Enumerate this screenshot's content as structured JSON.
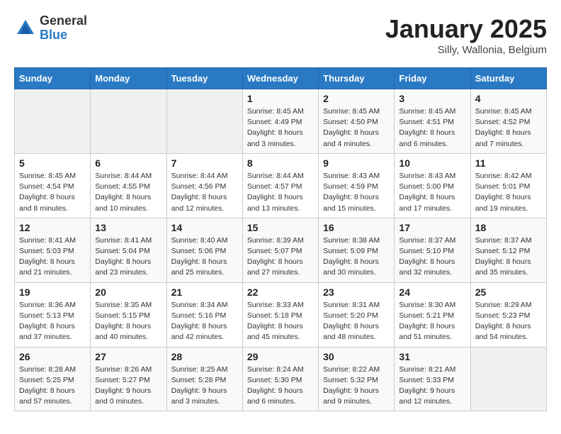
{
  "header": {
    "logo_general": "General",
    "logo_blue": "Blue",
    "title": "January 2025",
    "subtitle": "Silly, Wallonia, Belgium"
  },
  "days_of_week": [
    "Sunday",
    "Monday",
    "Tuesday",
    "Wednesday",
    "Thursday",
    "Friday",
    "Saturday"
  ],
  "weeks": [
    {
      "days": [
        {
          "number": "",
          "info": "",
          "empty": true
        },
        {
          "number": "",
          "info": "",
          "empty": true
        },
        {
          "number": "",
          "info": "",
          "empty": true
        },
        {
          "number": "1",
          "info": "Sunrise: 8:45 AM\nSunset: 4:49 PM\nDaylight: 8 hours\nand 3 minutes.",
          "empty": false
        },
        {
          "number": "2",
          "info": "Sunrise: 8:45 AM\nSunset: 4:50 PM\nDaylight: 8 hours\nand 4 minutes.",
          "empty": false
        },
        {
          "number": "3",
          "info": "Sunrise: 8:45 AM\nSunset: 4:51 PM\nDaylight: 8 hours\nand 6 minutes.",
          "empty": false
        },
        {
          "number": "4",
          "info": "Sunrise: 8:45 AM\nSunset: 4:52 PM\nDaylight: 8 hours\nand 7 minutes.",
          "empty": false
        }
      ]
    },
    {
      "days": [
        {
          "number": "5",
          "info": "Sunrise: 8:45 AM\nSunset: 4:54 PM\nDaylight: 8 hours\nand 8 minutes.",
          "empty": false
        },
        {
          "number": "6",
          "info": "Sunrise: 8:44 AM\nSunset: 4:55 PM\nDaylight: 8 hours\nand 10 minutes.",
          "empty": false
        },
        {
          "number": "7",
          "info": "Sunrise: 8:44 AM\nSunset: 4:56 PM\nDaylight: 8 hours\nand 12 minutes.",
          "empty": false
        },
        {
          "number": "8",
          "info": "Sunrise: 8:44 AM\nSunset: 4:57 PM\nDaylight: 8 hours\nand 13 minutes.",
          "empty": false
        },
        {
          "number": "9",
          "info": "Sunrise: 8:43 AM\nSunset: 4:59 PM\nDaylight: 8 hours\nand 15 minutes.",
          "empty": false
        },
        {
          "number": "10",
          "info": "Sunrise: 8:43 AM\nSunset: 5:00 PM\nDaylight: 8 hours\nand 17 minutes.",
          "empty": false
        },
        {
          "number": "11",
          "info": "Sunrise: 8:42 AM\nSunset: 5:01 PM\nDaylight: 8 hours\nand 19 minutes.",
          "empty": false
        }
      ]
    },
    {
      "days": [
        {
          "number": "12",
          "info": "Sunrise: 8:41 AM\nSunset: 5:03 PM\nDaylight: 8 hours\nand 21 minutes.",
          "empty": false
        },
        {
          "number": "13",
          "info": "Sunrise: 8:41 AM\nSunset: 5:04 PM\nDaylight: 8 hours\nand 23 minutes.",
          "empty": false
        },
        {
          "number": "14",
          "info": "Sunrise: 8:40 AM\nSunset: 5:06 PM\nDaylight: 8 hours\nand 25 minutes.",
          "empty": false
        },
        {
          "number": "15",
          "info": "Sunrise: 8:39 AM\nSunset: 5:07 PM\nDaylight: 8 hours\nand 27 minutes.",
          "empty": false
        },
        {
          "number": "16",
          "info": "Sunrise: 8:38 AM\nSunset: 5:09 PM\nDaylight: 8 hours\nand 30 minutes.",
          "empty": false
        },
        {
          "number": "17",
          "info": "Sunrise: 8:37 AM\nSunset: 5:10 PM\nDaylight: 8 hours\nand 32 minutes.",
          "empty": false
        },
        {
          "number": "18",
          "info": "Sunrise: 8:37 AM\nSunset: 5:12 PM\nDaylight: 8 hours\nand 35 minutes.",
          "empty": false
        }
      ]
    },
    {
      "days": [
        {
          "number": "19",
          "info": "Sunrise: 8:36 AM\nSunset: 5:13 PM\nDaylight: 8 hours\nand 37 minutes.",
          "empty": false
        },
        {
          "number": "20",
          "info": "Sunrise: 8:35 AM\nSunset: 5:15 PM\nDaylight: 8 hours\nand 40 minutes.",
          "empty": false
        },
        {
          "number": "21",
          "info": "Sunrise: 8:34 AM\nSunset: 5:16 PM\nDaylight: 8 hours\nand 42 minutes.",
          "empty": false
        },
        {
          "number": "22",
          "info": "Sunrise: 8:33 AM\nSunset: 5:18 PM\nDaylight: 8 hours\nand 45 minutes.",
          "empty": false
        },
        {
          "number": "23",
          "info": "Sunrise: 8:31 AM\nSunset: 5:20 PM\nDaylight: 8 hours\nand 48 minutes.",
          "empty": false
        },
        {
          "number": "24",
          "info": "Sunrise: 8:30 AM\nSunset: 5:21 PM\nDaylight: 8 hours\nand 51 minutes.",
          "empty": false
        },
        {
          "number": "25",
          "info": "Sunrise: 8:29 AM\nSunset: 5:23 PM\nDaylight: 8 hours\nand 54 minutes.",
          "empty": false
        }
      ]
    },
    {
      "days": [
        {
          "number": "26",
          "info": "Sunrise: 8:28 AM\nSunset: 5:25 PM\nDaylight: 8 hours\nand 57 minutes.",
          "empty": false
        },
        {
          "number": "27",
          "info": "Sunrise: 8:26 AM\nSunset: 5:27 PM\nDaylight: 9 hours\nand 0 minutes.",
          "empty": false
        },
        {
          "number": "28",
          "info": "Sunrise: 8:25 AM\nSunset: 5:28 PM\nDaylight: 9 hours\nand 3 minutes.",
          "empty": false
        },
        {
          "number": "29",
          "info": "Sunrise: 8:24 AM\nSunset: 5:30 PM\nDaylight: 9 hours\nand 6 minutes.",
          "empty": false
        },
        {
          "number": "30",
          "info": "Sunrise: 8:22 AM\nSunset: 5:32 PM\nDaylight: 9 hours\nand 9 minutes.",
          "empty": false
        },
        {
          "number": "31",
          "info": "Sunrise: 8:21 AM\nSunset: 5:33 PM\nDaylight: 9 hours\nand 12 minutes.",
          "empty": false
        },
        {
          "number": "",
          "info": "",
          "empty": true
        }
      ]
    }
  ]
}
